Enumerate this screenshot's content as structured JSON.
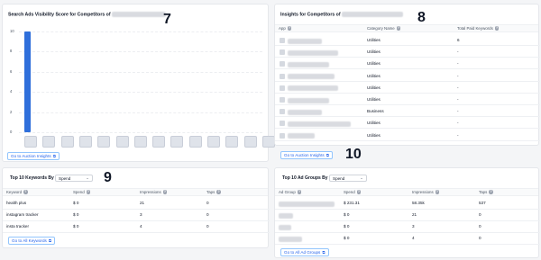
{
  "annotations": {
    "n1": "7",
    "n2": "8",
    "n3": "9",
    "n4": "10"
  },
  "visibility": {
    "title": "Search Ads Visibility Score for Competitors of",
    "y_ticks": [
      "10",
      "8",
      "6",
      "4",
      "2",
      "0"
    ],
    "link": "Go to Auction Insights",
    "chart_data": {
      "type": "bar",
      "title": "Search Ads Visibility Score for Competitors of",
      "categories": [
        "",
        "",
        "",
        "",
        "",
        "",
        "",
        "",
        "",
        "",
        "",
        "",
        "",
        ""
      ],
      "values": [
        10,
        0,
        0,
        0,
        0,
        0,
        0,
        0,
        0,
        0,
        0,
        0,
        0,
        0
      ],
      "ylim": [
        0,
        10
      ],
      "grid": true
    }
  },
  "insights": {
    "title": "Insights for Competitors of",
    "columns": [
      "App",
      "Category Name",
      "Total Paid Keywords"
    ],
    "rows": [
      {
        "category": "Utilities",
        "keywords": "6"
      },
      {
        "category": "Utilities",
        "keywords": "-"
      },
      {
        "category": "Utilities",
        "keywords": "-"
      },
      {
        "category": "Utilities",
        "keywords": "-"
      },
      {
        "category": "Utilities",
        "keywords": "-"
      },
      {
        "category": "Utilities",
        "keywords": "-"
      },
      {
        "category": "Business",
        "keywords": "-"
      },
      {
        "category": "Utilities",
        "keywords": "-"
      },
      {
        "category": "Utilities",
        "keywords": "-"
      }
    ],
    "link": "Go to Auction Insights"
  },
  "keywords": {
    "title": "Top 10 Keywords By",
    "select_value": "Spend",
    "columns": [
      "Keyword",
      "Spend",
      "Impressions",
      "Taps"
    ],
    "rows": [
      {
        "keyword": "health plus",
        "spend": "$ 0",
        "impressions": "21",
        "taps": "0"
      },
      {
        "keyword": "instagram tracker",
        "spend": "$ 0",
        "impressions": "3",
        "taps": "0"
      },
      {
        "keyword": "insta tracker",
        "spend": "$ 0",
        "impressions": "4",
        "taps": "0"
      }
    ],
    "link": "Go to All Keywords"
  },
  "adgroups": {
    "title": "Top 10 Ad Groups By",
    "select_value": "Spend",
    "columns": [
      "Ad Group",
      "Spend",
      "Impressions",
      "Taps"
    ],
    "rows": [
      {
        "spend": "$ 231.31",
        "impressions": "58.35k",
        "taps": "537"
      },
      {
        "spend": "$ 0",
        "impressions": "21",
        "taps": "0"
      },
      {
        "spend": "$ 0",
        "impressions": "3",
        "taps": "0"
      },
      {
        "spend": "$ 0",
        "impressions": "4",
        "taps": "0"
      }
    ],
    "link": "Go to All Ad Groups"
  },
  "colors": {
    "bar": "#2f6fdb",
    "link": "#2563eb"
  }
}
